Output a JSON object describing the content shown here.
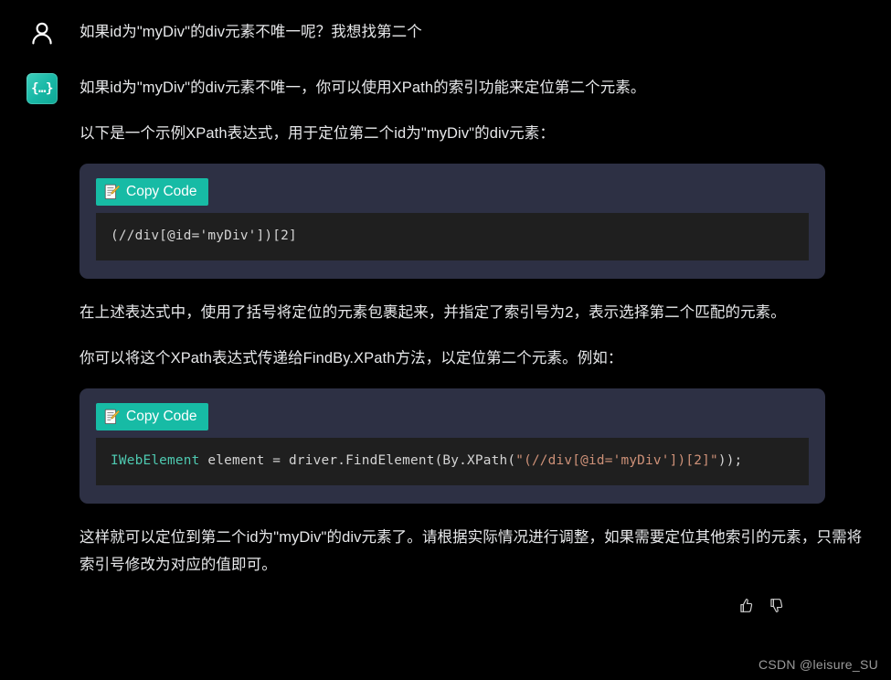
{
  "theme": {
    "page_background": "#000000",
    "text_color": "#e7e8ea",
    "accent_teal": "#17bba5",
    "code_wrapper_background": "#2d3044",
    "code_area_background": "#1f1f1f",
    "code_type_color": "#4ec9b0",
    "code_string_color": "#ce9178",
    "watermark_color": "#9a9a9a"
  },
  "user_message": {
    "avatar_icon": "person-icon",
    "text": "如果id为\"myDiv\"的div元素不唯一呢？我想找第二个"
  },
  "assistant_message": {
    "avatar_icon": "code-braces-icon",
    "avatar_glyph": "{…}",
    "paragraph_1": "如果id为\"myDiv\"的div元素不唯一，你可以使用XPath的索引功能来定位第二个元素。",
    "paragraph_2": "以下是一个示例XPath表达式，用于定位第二个id为\"myDiv\"的div元素：",
    "paragraph_3": "在上述表达式中，使用了括号将定位的元素包裹起来，并指定了索引号为2，表示选择第二个匹配的元素。",
    "paragraph_4": "你可以将这个XPath表达式传递给FindBy.XPath方法，以定位第二个元素。例如：",
    "paragraph_5": "这样就可以定位到第二个id为\"myDiv\"的div元素了。请根据实际情况进行调整，如果需要定位其他索引的元素，只需将索引号修改为对应的值即可。",
    "code_blocks": [
      {
        "copy_label": "Copy Code",
        "copy_icon": "memo-pencil-icon",
        "language": "xpath",
        "code": "(//div[@id='myDiv'])[2]",
        "tokens": [
          {
            "text": "(//div[@id='myDiv'])[2]",
            "type": "plain"
          }
        ]
      },
      {
        "copy_label": "Copy Code",
        "copy_icon": "memo-pencil-icon",
        "language": "csharp",
        "code": "IWebElement element = driver.FindElement(By.XPath(\"(//div[@id='myDiv'])[2]\"));",
        "tokens": [
          {
            "text": "IWebElement",
            "type": "type"
          },
          {
            "text": " element = driver.FindElement(By.XPath(",
            "type": "plain"
          },
          {
            "text": "\"(//div[@id='myDiv'])[2]\"",
            "type": "string"
          },
          {
            "text": "));",
            "type": "plain"
          }
        ]
      }
    ],
    "feedback": {
      "thumbs_up_icon": "thumbs-up-icon",
      "thumbs_down_icon": "thumbs-down-icon"
    }
  },
  "watermark": {
    "text": "CSDN @leisure_SU"
  }
}
